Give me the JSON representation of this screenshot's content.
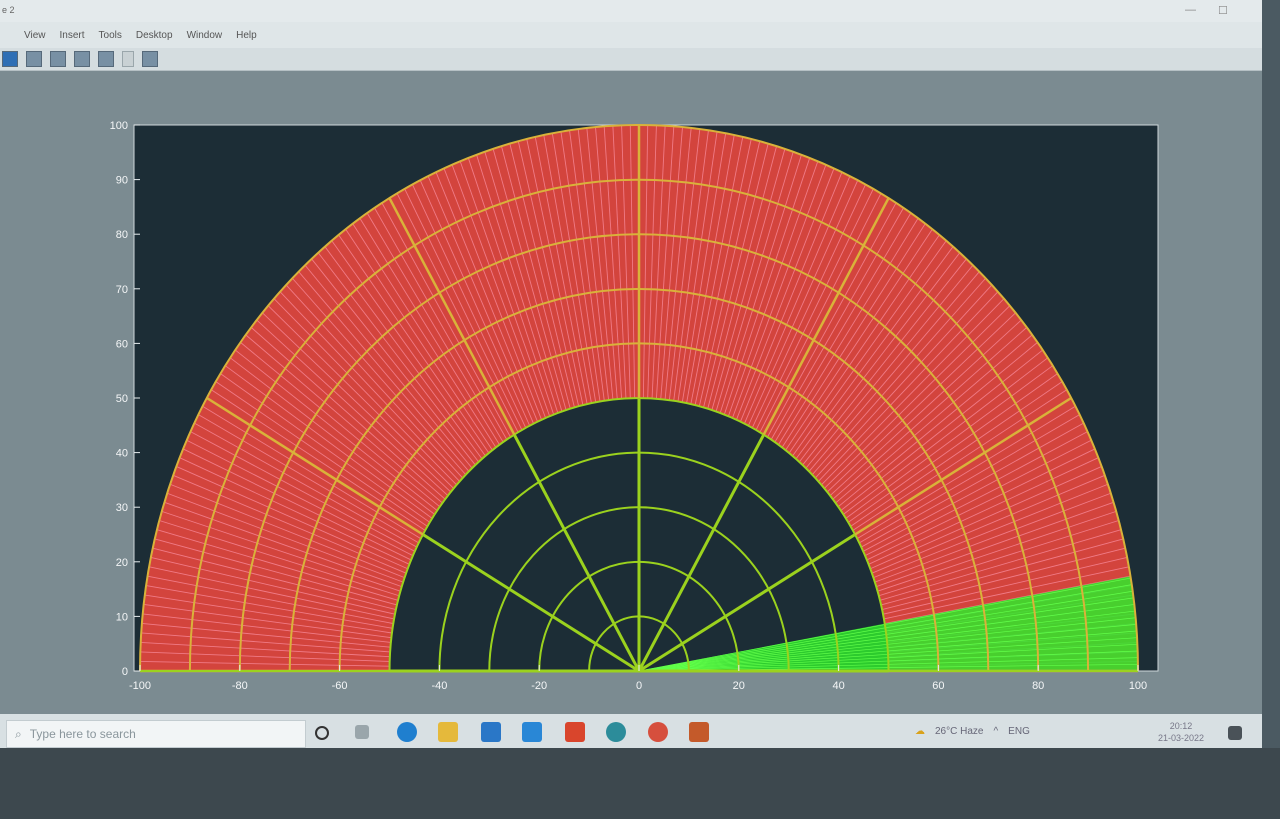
{
  "window": {
    "title": "e 2",
    "menu": [
      "View",
      "Insert",
      "Tools",
      "Desktop",
      "Window",
      "Help"
    ]
  },
  "toolbar": {
    "icons": [
      "save-icon",
      "print-icon",
      "copy-icon",
      "page-icon",
      "layout-icon",
      "pointer-icon",
      "dock-icon"
    ]
  },
  "chart_data": {
    "type": "polar-radar",
    "xlim": [
      -100,
      100
    ],
    "ylim": [
      0,
      100
    ],
    "x_ticks": [
      -100,
      -80,
      -60,
      -40,
      -20,
      0,
      20,
      40,
      60,
      80,
      100
    ],
    "y_ticks": [
      0,
      10,
      20,
      30,
      40,
      50,
      60,
      70,
      80,
      90,
      100
    ],
    "inner_rings": [
      10,
      20,
      30,
      40,
      50
    ],
    "outer_rings": [
      60,
      70,
      80,
      90,
      100
    ],
    "spokes_deg": [
      0,
      30,
      60,
      90,
      120,
      150,
      180
    ],
    "detected_object_range_from": 50,
    "sweep_angle_deg": 10,
    "colors": {
      "axes_bg": "#1c2d36",
      "inner_grid": "#9bd21e",
      "outer_grid": "#d9b23a",
      "detected_fill": "#e8473e",
      "sweep_fill": "#2fe82b"
    }
  },
  "taskbar": {
    "search_placeholder": "Type here to search",
    "weather": "26°C Haze",
    "lang": "ENG",
    "time": "20:12",
    "date": "21-03-2022",
    "apps": [
      "cortana-icon",
      "taskview-icon",
      "edge-icon",
      "files-icon",
      "mail-icon",
      "store-icon",
      "office-icon",
      "teams-icon",
      "chrome-icon",
      "matlab-icon"
    ]
  }
}
